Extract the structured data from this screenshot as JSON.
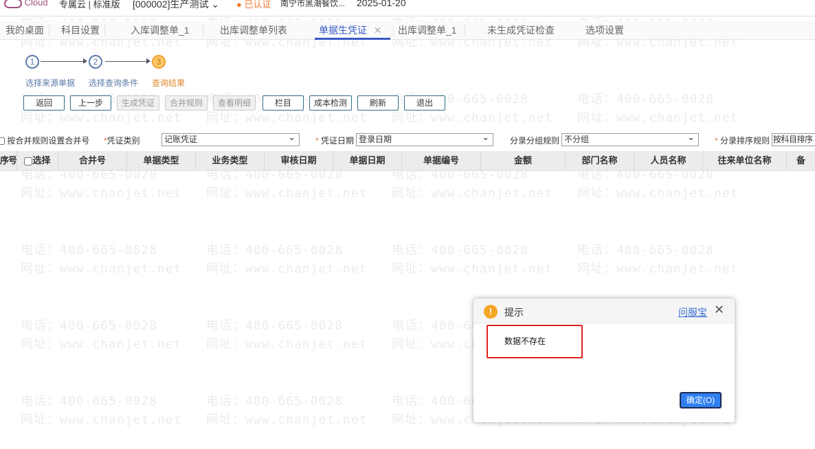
{
  "topbar": {
    "logo": "Cloud",
    "edition": "专属云 | 标准版",
    "account": "[000002]生产测试",
    "certified": "已认证",
    "company": "南宁市黑潮餐饮...",
    "date": "2025-01-20"
  },
  "tabs": [
    {
      "label": "我的桌面"
    },
    {
      "label": "科目设置"
    },
    {
      "label": "入库调整单_1"
    },
    {
      "label": "出库调整单列表"
    },
    {
      "label": "单据生凭证",
      "active": true
    },
    {
      "label": "出库调整单_1"
    },
    {
      "label": "未生成凭证检查"
    },
    {
      "label": "选项设置"
    }
  ],
  "steps": [
    {
      "num": "1",
      "label": "选择来源单据"
    },
    {
      "num": "2",
      "label": "选择查询条件"
    },
    {
      "num": "3",
      "label": "查询结果",
      "current": true
    }
  ],
  "toolbar": [
    "返回",
    "上一步",
    "生成凭证",
    "合并规则",
    "查看明细",
    "栏目",
    "成本检测",
    "刷新",
    "退出"
  ],
  "filters": {
    "merge_checkbox": "按合并规则设置合并号",
    "voucher_type_label": "凭证类别",
    "voucher_type": "记账凭证",
    "voucher_date_label": "凭证日期",
    "voucher_date": "登录日期",
    "group_rule_label": "分录分组规则",
    "group_rule": "不分组",
    "sort_rule_label": "分录排序规则",
    "sort_rule": "按科目排序"
  },
  "table": {
    "columns": [
      "序号",
      "选择",
      "合并号",
      "单据类型",
      "业务类型",
      "审核日期",
      "单据日期",
      "单据编号",
      "金额",
      "部门名称",
      "人员名称",
      "往来单位名称",
      "备"
    ]
  },
  "watermark": {
    "phone": "电话：400-665-0028",
    "site": "网址：www.chanjet.net"
  },
  "dialog": {
    "title": "提示",
    "help_link": "问服宝",
    "message": "数据不存在",
    "ok": "确定(O)"
  },
  "colors": {
    "accent": "#3a58c4",
    "warning": "#f5a623",
    "highlight": "#e02020",
    "ok": "#2f7ff0"
  }
}
